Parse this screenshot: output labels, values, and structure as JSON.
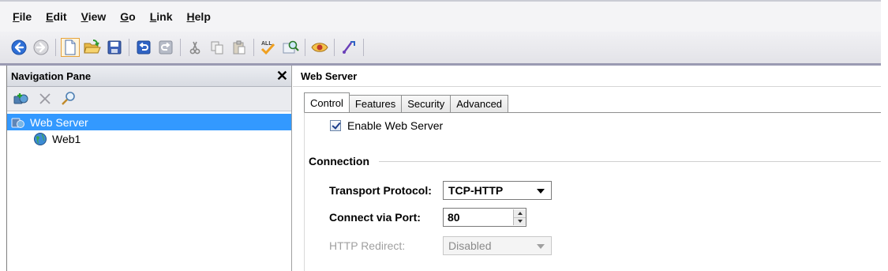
{
  "menubar": {
    "items": [
      {
        "mnemonic": "F",
        "rest": "ile"
      },
      {
        "mnemonic": "E",
        "rest": "dit"
      },
      {
        "mnemonic": "V",
        "rest": "iew"
      },
      {
        "mnemonic": "G",
        "rest": "o"
      },
      {
        "mnemonic": "L",
        "rest": "ink"
      },
      {
        "mnemonic": "H",
        "rest": "elp"
      }
    ]
  },
  "toolbar": {
    "buttons": [
      "back-icon",
      "forward-icon",
      "new-document-icon",
      "open-folder-icon",
      "save-icon",
      "undo-icon",
      "redo-icon",
      "cut-icon",
      "copy-icon",
      "paste-icon",
      "spell-check-all-icon",
      "find-icon",
      "view-icon",
      "connect-icon"
    ],
    "active": "new-document-icon"
  },
  "nav_pane": {
    "title": "Navigation Pane",
    "close_glyph": "✕",
    "tools": [
      "add-server-icon",
      "delete-icon",
      "search-icon"
    ],
    "tree": [
      {
        "label": "Web Server",
        "icon": "server-icon",
        "selected": true
      },
      {
        "label": "Web1",
        "icon": "globe-icon",
        "selected": false
      }
    ]
  },
  "content": {
    "title": "Web Server",
    "tabs": [
      {
        "label": "Control",
        "active": true
      },
      {
        "label": "Features",
        "active": false
      },
      {
        "label": "Security",
        "active": false
      },
      {
        "label": "Advanced",
        "active": false
      }
    ],
    "enable_checkbox": {
      "label": "Enable Web Server",
      "checked": true
    },
    "connection": {
      "group_title": "Connection",
      "transport_label": "Transport Protocol:",
      "transport_value": "TCP-HTTP",
      "port_label": "Connect via Port:",
      "port_value": "80",
      "redirect_label": "HTTP Redirect:",
      "redirect_value": "Disabled"
    }
  },
  "colors": {
    "selection": "#3399ff",
    "toolbar_border": "#9a9ab2",
    "active_toolbar_button": "#e5a23c"
  }
}
